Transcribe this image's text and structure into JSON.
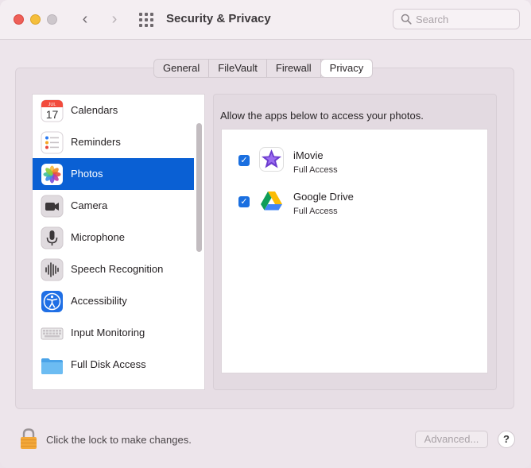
{
  "window": {
    "title": "Security & Privacy",
    "search_placeholder": "Search"
  },
  "nav": {
    "back_glyph": "‹",
    "forward_glyph": "›"
  },
  "tabs": [
    {
      "label": "General",
      "active": false
    },
    {
      "label": "FileVault",
      "active": false
    },
    {
      "label": "Firewall",
      "active": false
    },
    {
      "label": "Privacy",
      "active": true
    }
  ],
  "sidebar": {
    "selected": "Photos",
    "items": [
      {
        "label": "Calendars",
        "icon": "calendar-icon",
        "calendar_month": "JUL",
        "calendar_day": "17"
      },
      {
        "label": "Reminders",
        "icon": "reminders-icon"
      },
      {
        "label": "Photos",
        "icon": "photos-icon"
      },
      {
        "label": "Camera",
        "icon": "camera-icon"
      },
      {
        "label": "Microphone",
        "icon": "microphone-icon"
      },
      {
        "label": "Speech Recognition",
        "icon": "waveform-icon"
      },
      {
        "label": "Accessibility",
        "icon": "accessibility-icon"
      },
      {
        "label": "Input Monitoring",
        "icon": "keyboard-icon"
      },
      {
        "label": "Full Disk Access",
        "icon": "folder-icon"
      }
    ]
  },
  "photos_pane": {
    "caption": "Allow the apps below to access your photos.",
    "apps": [
      {
        "name": "iMovie",
        "access": "Full Access",
        "checked": true,
        "icon": "imovie-icon"
      },
      {
        "name": "Google Drive",
        "access": "Full Access",
        "checked": true,
        "icon": "google-drive-icon"
      }
    ]
  },
  "footer": {
    "lock_text": "Click the lock to make changes.",
    "advanced_label": "Advanced...",
    "help_label": "?"
  },
  "colors": {
    "selection": "#0a60d4",
    "checkbox": "#1a6fe0",
    "window_bg": "#ede5eb"
  }
}
